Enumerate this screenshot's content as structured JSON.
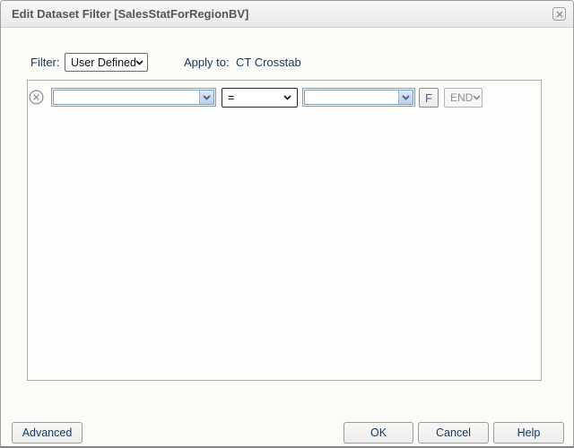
{
  "dialog": {
    "title": "Edit Dataset Filter [SalesStatForRegionBV]"
  },
  "filter_bar": {
    "filter_label": "Filter:",
    "filter_type": "User Defined",
    "apply_to_label": "Apply to:",
    "apply_to_target": "CT Crosstab"
  },
  "condition_row": {
    "field_value": "",
    "operator": "=",
    "value": "",
    "formula_button": "F",
    "logic_operator": "END"
  },
  "footer": {
    "advanced": "Advanced",
    "ok": "OK",
    "cancel": "Cancel",
    "help": "Help"
  },
  "icons": {
    "close": "x-glyph",
    "delete_condition": "circled-x-glyph",
    "dropdown_arrow": "chevron-down-glyph"
  },
  "colors": {
    "label_text": "#17375e",
    "title_text": "#565656",
    "combo_border": "#7aa1bb",
    "combo_arrow": "#44699d",
    "disabled_text": "#8f8f8f"
  }
}
